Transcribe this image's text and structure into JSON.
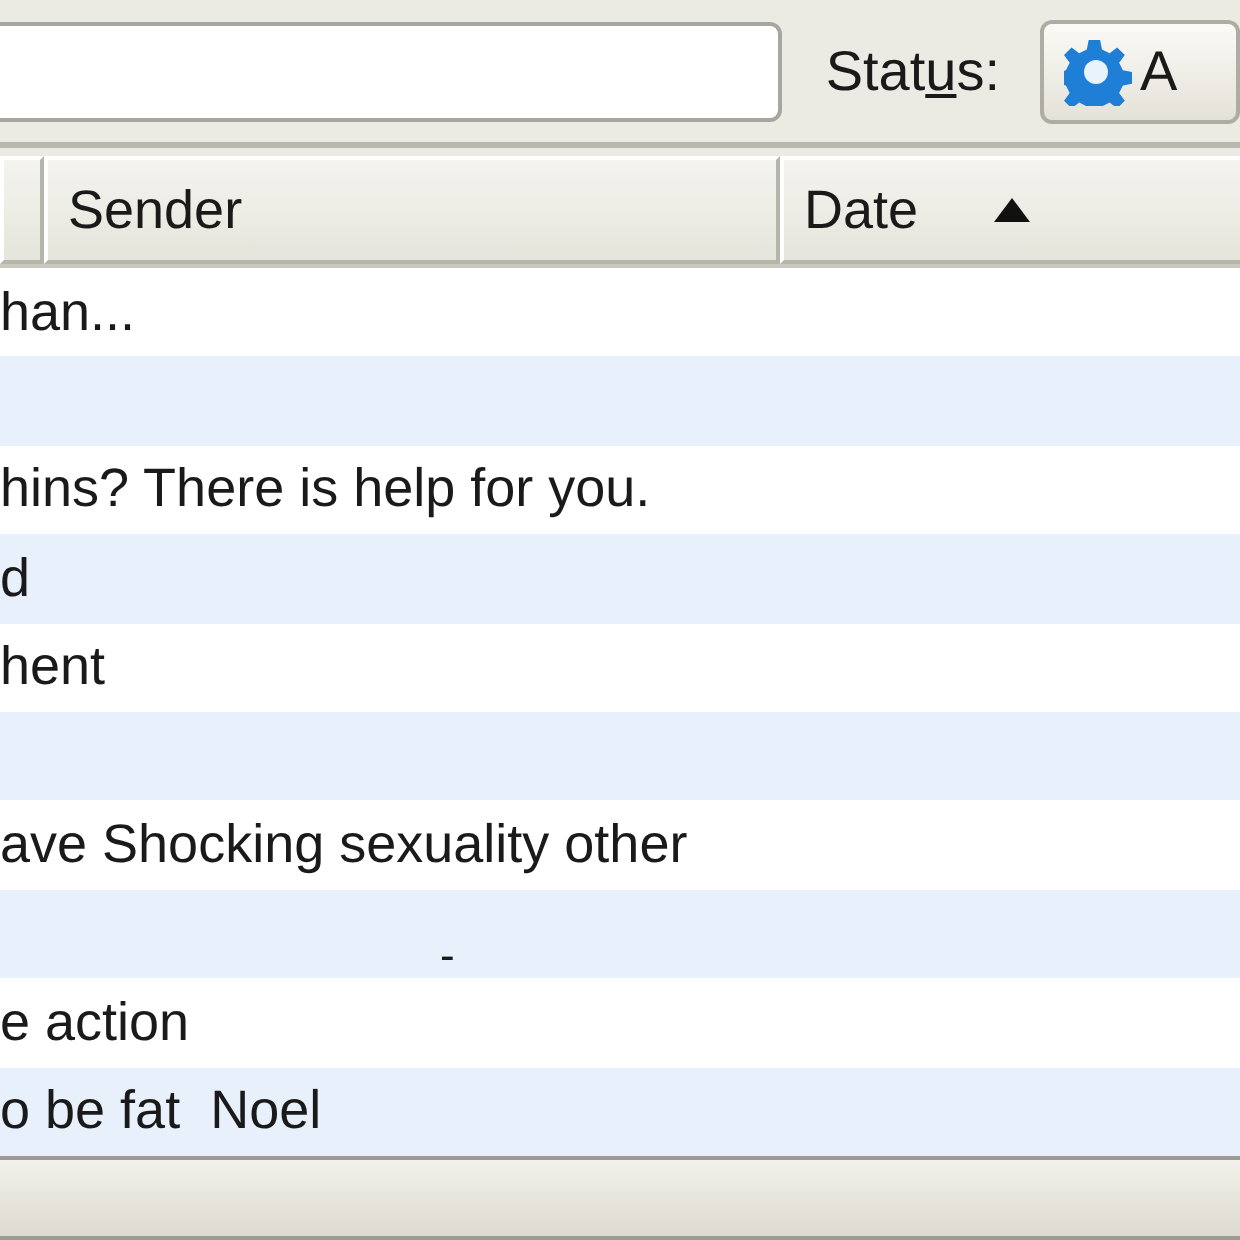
{
  "toolbar": {
    "status": {
      "label_before": "Stat",
      "access_key": "u",
      "label_after": "s:"
    },
    "status_button": {
      "label": "A"
    }
  },
  "table": {
    "columns": [
      {
        "kind": "stub"
      },
      {
        "label": "Sender",
        "kind": "text"
      },
      {
        "label": "Date",
        "kind": "sort",
        "sort_ascending": true
      }
    ],
    "rows": [
      {
        "subject": "han..."
      },
      {
        "subject": ""
      },
      {
        "subject": "hins? There is help for you."
      },
      {
        "subject": "d"
      },
      {
        "subject": "hent"
      },
      {
        "subject": ""
      },
      {
        "subject": "ave Shocking sexuality other"
      },
      {
        "subject": "",
        "sender": "-"
      },
      {
        "subject": "e action"
      },
      {
        "subject": "o be fat  Noel"
      }
    ]
  }
}
